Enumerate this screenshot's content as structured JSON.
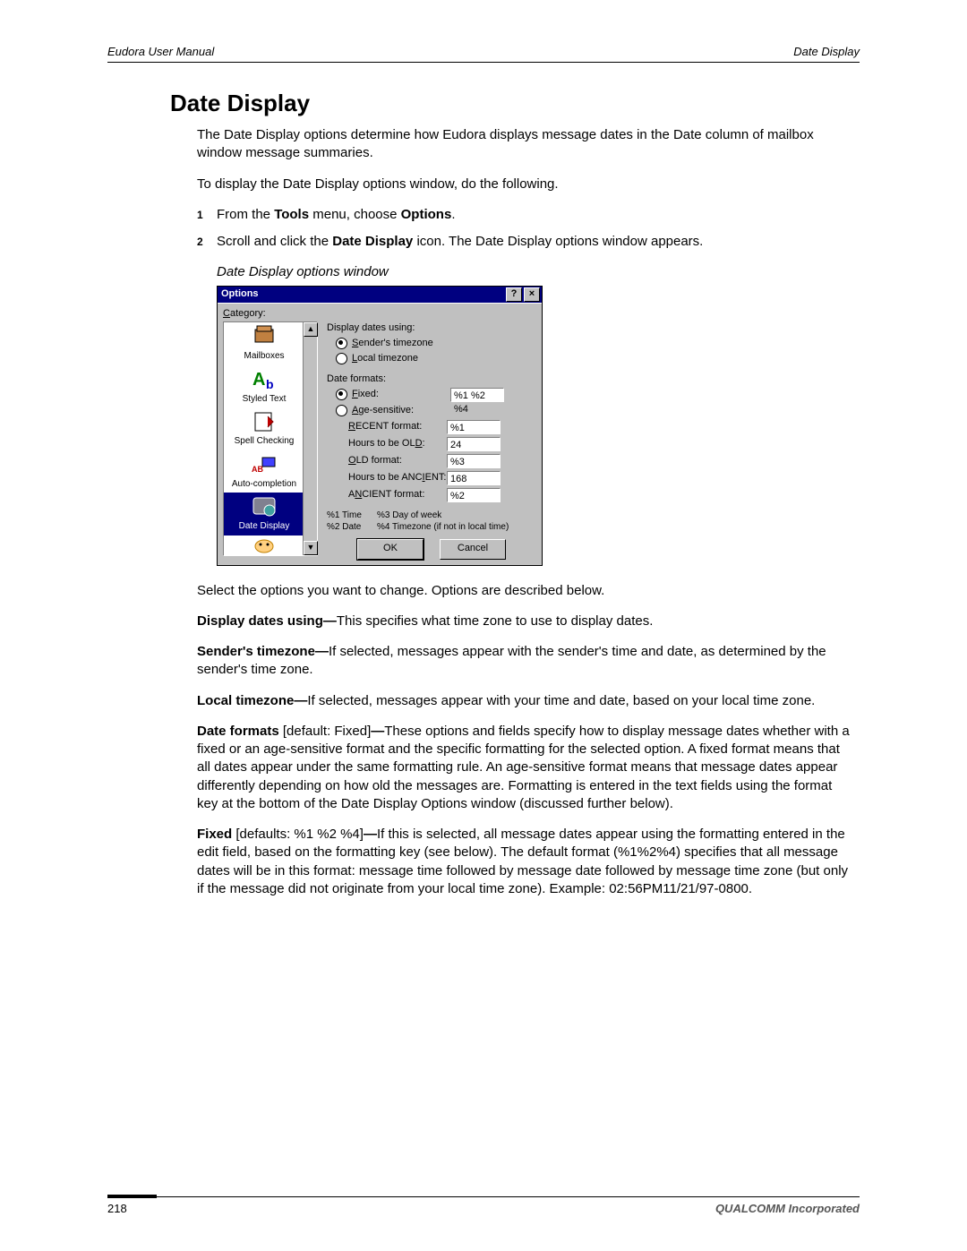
{
  "header": {
    "left": "Eudora User Manual",
    "right": "Date Display"
  },
  "title": "Date Display",
  "intro1": "The Date Display options determine how Eudora displays message dates in the Date column of mailbox window message summaries.",
  "intro2": "To display the Date Display options window, do the following.",
  "steps": {
    "s1_num": "1",
    "s1_a": "From the ",
    "s1_b": "Tools",
    "s1_c": " menu, choose ",
    "s1_d": "Options",
    "s1_e": ".",
    "s2_num": "2",
    "s2_a": "Scroll and click the ",
    "s2_b": "Date Display",
    "s2_c": " icon. The Date Display options window appears."
  },
  "caption": "Date Display options window",
  "dialog": {
    "title": "Options",
    "help": "?",
    "close": "×",
    "category_label": "Category:",
    "category_underline": "C",
    "scroll_up": "▲",
    "scroll_down": "▼",
    "categories": [
      {
        "label": "Mailboxes"
      },
      {
        "label": "Styled Text"
      },
      {
        "label": "Spell Checking"
      },
      {
        "label": "Auto-completion"
      },
      {
        "label": "Date Display",
        "selected": true
      },
      {
        "label": ""
      }
    ],
    "grp1_label": "Display dates using:",
    "radio_sender": "Sender's timezone",
    "radio_sender_u": "S",
    "radio_local": "Local timezone",
    "radio_local_u": "L",
    "grp2_label": "Date formats:",
    "radio_fixed": "Fixed:",
    "radio_fixed_u": "F",
    "fixed_value": "%1 %2 %4",
    "radio_age": "Age-sensitive:",
    "radio_age_u": "A",
    "recent_label": "RECENT format:",
    "recent_u": "R",
    "recent_value": "%1",
    "hours_old_label": "Hours to be OLD:",
    "hours_old_u": "D",
    "hours_old_value": "24",
    "old_label": "OLD format:",
    "old_u": "O",
    "old_value": "%3",
    "hours_anc_label": "Hours to be ANCIENT:",
    "hours_anc_u": "I",
    "hours_anc_value": "168",
    "anc_label": "ANCIENT format:",
    "anc_u": "N",
    "anc_value": "%2",
    "key_1": "%1 Time",
    "key_2": "%2 Date",
    "key_3": "%3 Day of week",
    "key_4": "%4 Timezone (if not in local time)",
    "ok": "OK",
    "cancel": "Cancel"
  },
  "after1": "Select the options you want to change. Options are described below.",
  "p_ddu_b": "Display dates using—",
  "p_ddu_t": "This specifies what time zone to use to display dates.",
  "p_stz_b": "Sender's timezone—",
  "p_stz_t": "If selected, messages appear with the sender's time and date, as determined by the sender's time zone.",
  "p_ltz_b": "Local timezone—",
  "p_ltz_t": "If selected, messages appear with your time and date, based on your local time zone.",
  "p_df_b": "Date formats ",
  "p_df_m": "[default: Fixed]",
  "p_df_dash": "—",
  "p_df_t": "These options and fields specify how to display message dates whether with a fixed or an age-sensitive format and the specific formatting for the selected option. A fixed format means that all dates appear under the same formatting rule. An age-sensitive format means that message dates appear differently depending on how old the messages are. Formatting is entered in the text fields using the format key at the bottom of the Date Display Options window (discussed further below).",
  "p_fx_b": "Fixed ",
  "p_fx_m": "[defaults: %1 %2 %4]",
  "p_fx_dash": "—",
  "p_fx_t": "If this is selected, all message dates appear using the formatting entered in the edit field, based on the formatting key (see below). The default format (%1%2%4) specifies that all message dates will be in this format: message time followed by message date followed by message time zone (but only if the message did not originate from your local time zone). Example: 02:56PM11/21/97-0800.",
  "footer": {
    "page": "218",
    "corp": "QUALCOMM Incorporated"
  }
}
